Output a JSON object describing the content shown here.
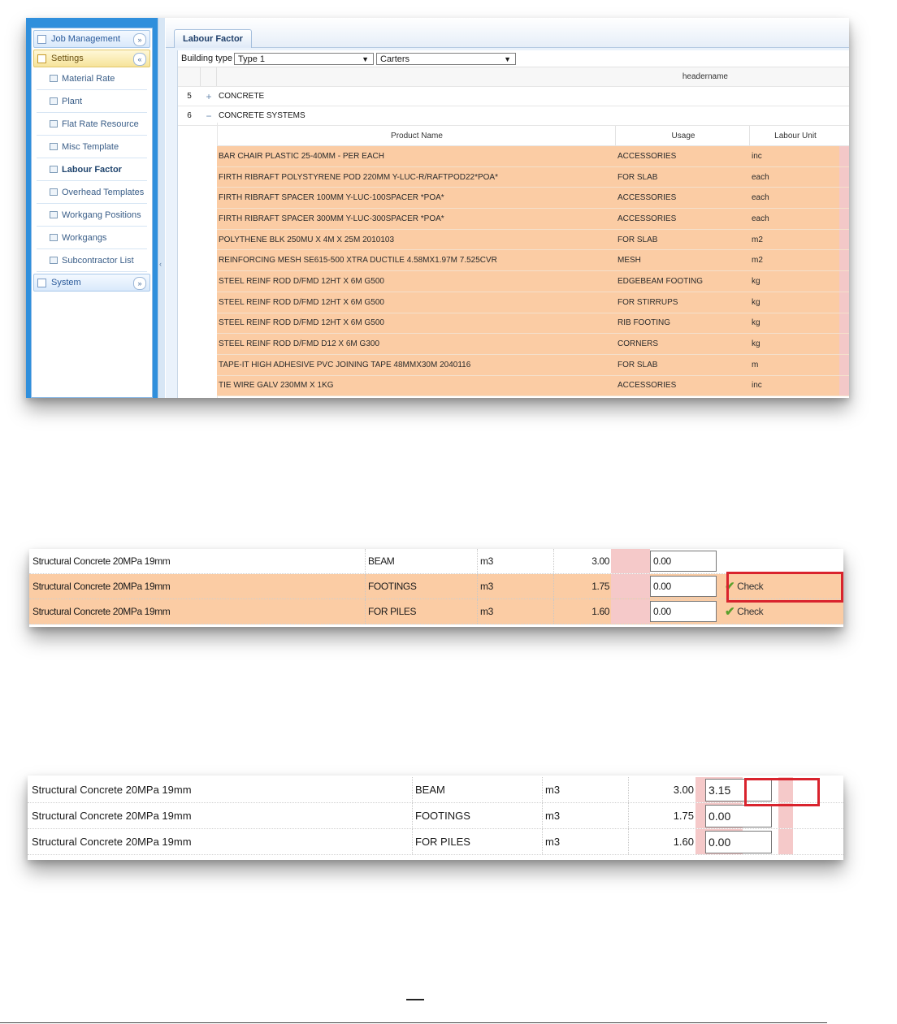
{
  "sidebar": {
    "sections": [
      {
        "label": "Job Management",
        "state": "collapsed"
      },
      {
        "label": "Settings",
        "state": "expanded"
      }
    ],
    "items": [
      "Material Rate",
      "Plant",
      "Flat Rate Resource",
      "Misc Template",
      "Labour Factor",
      "Overhead Templates",
      "Workgang Positions",
      "Workgangs",
      "Subcontractor List"
    ],
    "bottom_section": {
      "label": "System"
    },
    "active_item": "Labour Factor"
  },
  "tab": {
    "label": "Labour Factor"
  },
  "filters": {
    "building_type_label": "Building type",
    "building_type_value": "Type 1",
    "supplier_value": "Carters"
  },
  "grid": {
    "header": "headername",
    "groups": [
      {
        "num": "5",
        "toggle": "+",
        "name": "CONCRETE"
      },
      {
        "num": "6",
        "toggle": "−",
        "name": "CONCRETE SYSTEMS"
      }
    ],
    "columns": {
      "product": "Product Name",
      "usage": "Usage",
      "unit": "Labour Unit"
    },
    "rows": [
      {
        "name": "BAR CHAIR PLASTIC 25-40MM - PER EACH",
        "usage": "ACCESSORIES",
        "unit": "inc"
      },
      {
        "name": "FIRTH RIBRAFT POLYSTYRENE POD 220MM Y-LUC-R/RAFTPOD22*POA*",
        "usage": "FOR SLAB",
        "unit": "each"
      },
      {
        "name": "FIRTH RIBRAFT SPACER 100MM Y-LUC-100SPACER *POA*",
        "usage": "ACCESSORIES",
        "unit": "each"
      },
      {
        "name": "FIRTH RIBRAFT SPACER 300MM Y-LUC-300SPACER *POA*",
        "usage": "ACCESSORIES",
        "unit": "each"
      },
      {
        "name": "POLYTHENE BLK 250MU X 4M X 25M 2010103",
        "usage": "FOR SLAB",
        "unit": "m2"
      },
      {
        "name": "REINFORCING MESH SE615-500 XTRA DUCTILE 4.58MX1.97M 7.525CVR",
        "usage": "MESH",
        "unit": "m2"
      },
      {
        "name": "STEEL REINF ROD D/FMD 12HT X 6M G500",
        "usage": "EDGEBEAM FOOTING",
        "unit": "kg"
      },
      {
        "name": "STEEL REINF ROD D/FMD 12HT X 6M G500",
        "usage": "FOR STIRRUPS",
        "unit": "kg"
      },
      {
        "name": "STEEL REINF ROD D/FMD 12HT X 6M G500",
        "usage": "RIB FOOTING",
        "unit": "kg"
      },
      {
        "name": "STEEL REINF ROD D/FMD D12 X 6M G300",
        "usage": "CORNERS",
        "unit": "kg"
      },
      {
        "name": "TAPE-IT HIGH ADHESIVE PVC JOINING TAPE 48MMX30M 2040116",
        "usage": "FOR SLAB",
        "unit": "m"
      },
      {
        "name": "TIE WIRE GALV 230MM X 1KG",
        "usage": "ACCESSORIES",
        "unit": "inc"
      }
    ]
  },
  "shot2": {
    "rows": [
      {
        "name": "Structural Concrete 20MPa 19mm",
        "usage": "BEAM",
        "unit": "m3",
        "factor": "3.00",
        "input": "0.00",
        "action": ""
      },
      {
        "name": "Structural Concrete 20MPa 19mm",
        "usage": "FOOTINGS",
        "unit": "m3",
        "factor": "1.75",
        "input": "0.00",
        "action": "Check"
      },
      {
        "name": "Structural Concrete 20MPa 19mm",
        "usage": "FOR PILES",
        "unit": "m3",
        "factor": "1.60",
        "input": "0.00",
        "action": "Check"
      }
    ]
  },
  "shot3": {
    "rows": [
      {
        "name": "Structural Concrete 20MPa 19mm",
        "usage": "BEAM",
        "unit": "m3",
        "factor": "3.00",
        "input": "3.15"
      },
      {
        "name": "Structural Concrete 20MPa 19mm",
        "usage": "FOOTINGS",
        "unit": "m3",
        "factor": "1.75",
        "input": "0.00"
      },
      {
        "name": "Structural Concrete 20MPa 19mm",
        "usage": "FOR PILES",
        "unit": "m3",
        "factor": "1.60",
        "input": "0.00"
      }
    ]
  },
  "colors": {
    "row_highlight": "#fbcca4",
    "accent_blue": "#2f8fdc",
    "callout_red": "#d9232d",
    "check_green": "#5aa02c"
  }
}
